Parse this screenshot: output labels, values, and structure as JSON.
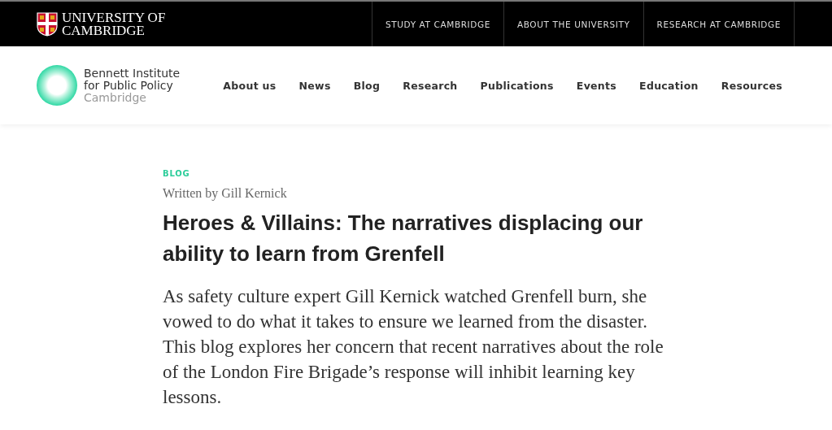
{
  "university_bar": {
    "logo_lines": [
      "UNIVERSITY OF",
      "CAMBRIDGE"
    ],
    "links": [
      "STUDY AT CAMBRIDGE",
      "ABOUT THE UNIVERSITY",
      "RESEARCH AT CAMBRIDGE"
    ]
  },
  "header": {
    "logo_lines": [
      "Bennett Institute",
      "for Public Policy",
      "Cambridge"
    ],
    "nav": [
      "About us",
      "News",
      "Blog",
      "Research",
      "Publications",
      "Events",
      "Education",
      "Resources"
    ]
  },
  "article": {
    "category": "BLOG",
    "byline": "Written by Gill Kernick",
    "title": "Heroes & Villains: The narratives displacing our ability to learn from Grenfell",
    "intro": "As safety culture expert Gill Kernick watched Grenfell burn, she vowed to do what it takes to ensure we learned from the disaster. This blog explores her concern that recent narratives about the role of the London Fire Brigade’s response will inhibit learning key lessons."
  }
}
